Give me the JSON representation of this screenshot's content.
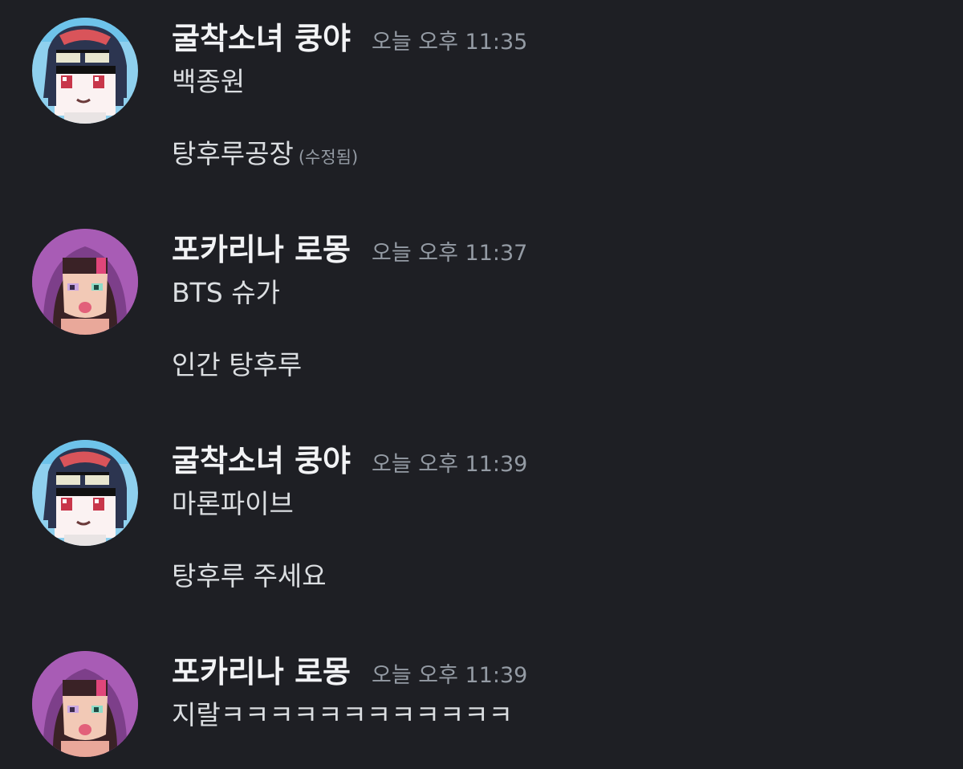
{
  "messages": [
    {
      "author": "굴착소녀 쿵야",
      "avatar_icon": "pixel-girl-sunglasses-avatar",
      "timestamp": "오늘 오후 11:35",
      "lines": [
        {
          "text": "백종원",
          "edited_label": ""
        },
        {
          "text": "탕후루공장",
          "edited_label": "(수정됨)"
        }
      ]
    },
    {
      "author": "포카리나 로몽",
      "avatar_icon": "hooded-girl-tongue-avatar",
      "timestamp": "오늘 오후 11:37",
      "lines": [
        {
          "text": "BTS 슈가",
          "edited_label": ""
        },
        {
          "text": "인간 탕후루",
          "edited_label": ""
        }
      ]
    },
    {
      "author": "굴착소녀 쿵야",
      "avatar_icon": "pixel-girl-sunglasses-avatar",
      "timestamp": "오늘 오후 11:39",
      "lines": [
        {
          "text": "마론파이브",
          "edited_label": ""
        },
        {
          "text": "탕후루 주세요",
          "edited_label": ""
        }
      ]
    },
    {
      "author": "포카리나 로몽",
      "avatar_icon": "hooded-girl-tongue-avatar",
      "timestamp": "오늘 오후 11:39",
      "lines": [
        {
          "text": "지랄ㅋㅋㅋㅋㅋㅋㅋㅋㅋㅋㅋㅋ",
          "edited_label": ""
        }
      ]
    }
  ]
}
